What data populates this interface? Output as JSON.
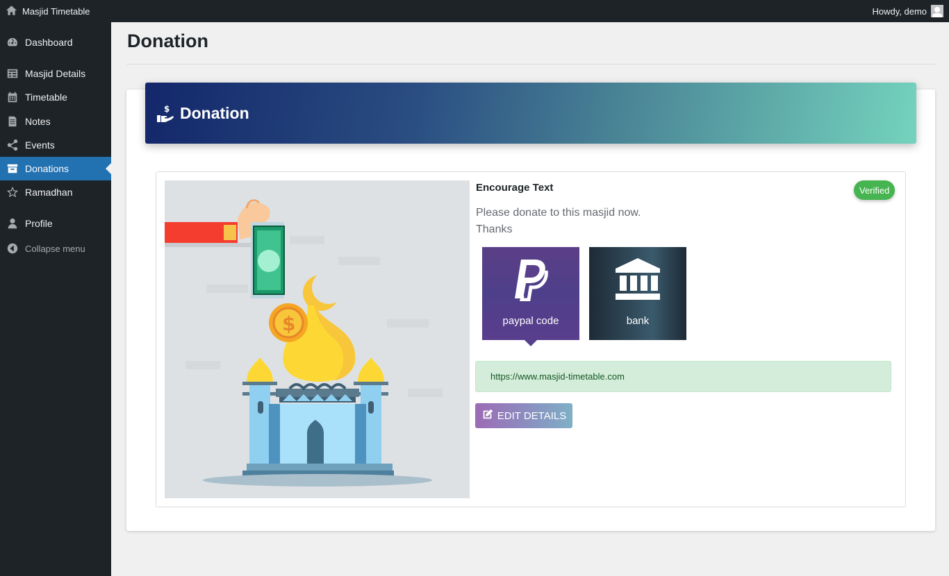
{
  "adminbar": {
    "site_name": "Masjid Timetable",
    "greeting": "Howdy, demo"
  },
  "sidebar": {
    "items": [
      {
        "label": "Dashboard",
        "icon": "dashboard-icon"
      },
      {
        "label": "Masjid Details",
        "icon": "table-icon"
      },
      {
        "label": "Timetable",
        "icon": "calendar-icon"
      },
      {
        "label": "Notes",
        "icon": "document-icon"
      },
      {
        "label": "Events",
        "icon": "share-icon"
      },
      {
        "label": "Donations",
        "icon": "archive-icon",
        "active": true
      },
      {
        "label": "Ramadhan",
        "icon": "star-icon"
      },
      {
        "label": "Profile",
        "icon": "user-icon"
      }
    ],
    "collapse_label": "Collapse menu"
  },
  "page": {
    "title": "Donation"
  },
  "card": {
    "header_title": "Donation",
    "encourage_title": "Encourage Text",
    "status_badge": "Verified",
    "encourage_line1": "Please donate to this masjid now.",
    "encourage_line2": "Thanks",
    "tiles": [
      {
        "label": "paypal code",
        "icon": "paypal-icon",
        "selected": true
      },
      {
        "label": "bank",
        "icon": "bank-icon"
      }
    ],
    "url": "https://www.masjid-timetable.com",
    "edit_button": "EDIT DETAILS"
  },
  "colors": {
    "sidebar_bg": "#1d2327",
    "active_menu": "#2271b1",
    "verified_badge": "#46b450",
    "url_box_bg": "#d4edda"
  }
}
